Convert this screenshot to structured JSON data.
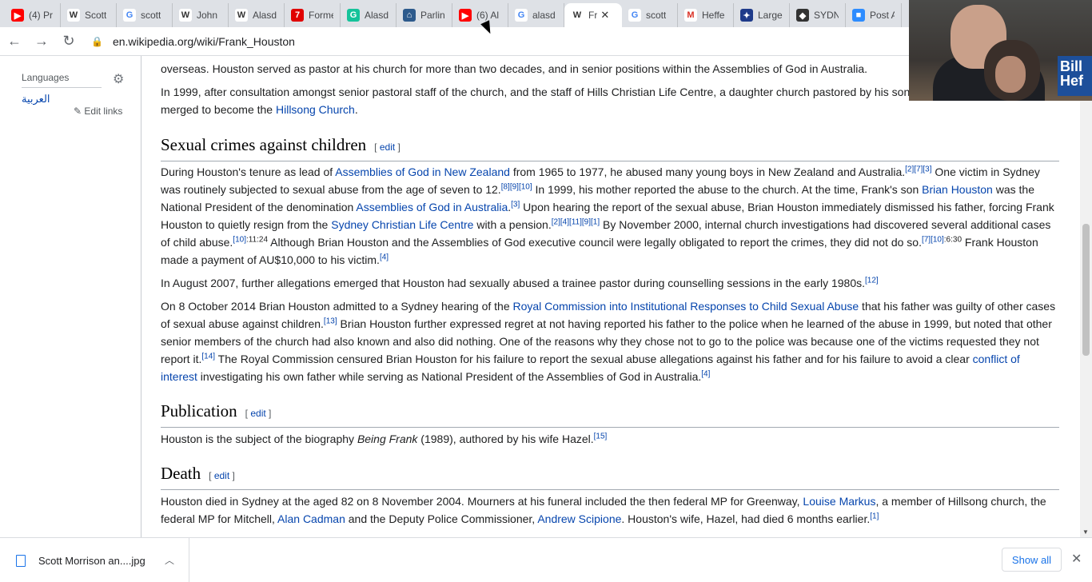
{
  "tabs": [
    {
      "icon": "youtube-icon",
      "color": "#ff0000",
      "glyph": "▶",
      "title": "(4) Pr"
    },
    {
      "icon": "wikipedia-icon",
      "color": "#ffffff",
      "glyph": "W",
      "title": "Scott"
    },
    {
      "icon": "google-icon",
      "color": "#ffffff",
      "glyph": "G",
      "title": "scott"
    },
    {
      "icon": "wikipedia-icon",
      "color": "#ffffff",
      "glyph": "W",
      "title": "John"
    },
    {
      "icon": "wikipedia-icon",
      "color": "#ffffff",
      "glyph": "W",
      "title": "Alasd"
    },
    {
      "icon": "seven-news-icon",
      "color": "#e00000",
      "glyph": "7",
      "title": "Forme"
    },
    {
      "icon": "grammarly-icon",
      "color": "#15c39a",
      "glyph": "G",
      "title": "Alasd"
    },
    {
      "icon": "parliament-icon",
      "color": "#2d5a8c",
      "glyph": "⌂",
      "title": "Parlin"
    },
    {
      "icon": "youtube-icon",
      "color": "#ff0000",
      "glyph": "▶",
      "title": "(6) Al"
    },
    {
      "icon": "google-icon",
      "color": "#ffffff",
      "glyph": "G",
      "title": "alasd"
    },
    {
      "icon": "wikipedia-icon",
      "color": "#ffffff",
      "glyph": "W",
      "title": "Fr",
      "active": true
    },
    {
      "icon": "google-icon",
      "color": "#ffffff",
      "glyph": "G",
      "title": "scott"
    },
    {
      "icon": "gmail-icon",
      "color": "#ffffff",
      "glyph": "M",
      "title": "Heffe"
    },
    {
      "icon": "masonic-icon",
      "color": "#1e3a8a",
      "glyph": "✦",
      "title": "Large"
    },
    {
      "icon": "sydney-icon",
      "color": "#333333",
      "glyph": "◆",
      "title": "SYDN"
    },
    {
      "icon": "zoom-icon",
      "color": "#2d8cff",
      "glyph": "■",
      "title": "Post A"
    }
  ],
  "address": {
    "url": "en.wikipedia.org/wiki/Frank_Houston"
  },
  "sidebar": {
    "languages_heading": "Languages",
    "arabic": "العربية",
    "edit_links": "✎ Edit links"
  },
  "intro": {
    "p1": "overseas. Houston served as pastor at his church for more than two decades, and in senior positions within the Assemblies of God in Australia.",
    "p2a": "In 1999, after consultation amongst senior pastoral staff of the church, and the staff of Hills Christian Life Centre, a daughter church pastored by his son",
    "p2b": "merged to become the ",
    "p2link": "Hillsong Church",
    "p2c": "."
  },
  "sec1": {
    "title": "Sexual crimes against children",
    "edit": "edit",
    "para1": {
      "t1": "During Houston's tenure as lead of ",
      "l1": "Assemblies of God in New Zealand",
      "t2": " from 1965 to 1977, he abused many young boys in New Zealand and Australia.",
      "s1": "[2][7][3]",
      "t3": " One victim in Sydney was routinely subjected to sexual abuse from the age of seven to 12.",
      "s2": "[8][9][10]",
      "t4": " In 1999, his mother reported the abuse to the church. At the time, Frank's son ",
      "l2": "Brian Houston",
      "t5": " was the National President of the denomination ",
      "l3": "Assemblies of God in Australia",
      "t6": ".",
      "s3": "[3]",
      "t7": " Upon hearing the report of the sexual abuse, Brian Houston immediately dismissed his father, forcing Frank Houston to quietly resign from the ",
      "l4": "Sydney Christian Life Centre",
      "t8": " with a pension.",
      "s4": "[2][4][11][9][1]",
      "t9": " By November 2000, internal church investigations had discovered several additional cases of child abuse.",
      "s5": "[10]",
      "s5p": ":11:24",
      "t10": " Although Brian Houston and the Assemblies of God executive council were legally obligated to report the crimes, they did not do so.",
      "s6": "[7][10]",
      "s6p": ":6:30",
      "t11": " Frank Houston made a payment of AU$10,000 to his victim.",
      "s7": "[4]"
    },
    "para2": {
      "t1": "In August 2007, further allegations emerged that Houston had sexually abused a trainee pastor during counselling sessions in the early 1980s.",
      "s1": "[12]"
    },
    "para3": {
      "t1": "On 8 October 2014 Brian Houston admitted to a Sydney hearing of the ",
      "l1": "Royal Commission into Institutional Responses to Child Sexual Abuse",
      "t2": " that his father was guilty of other cases of sexual abuse against children.",
      "s1": "[13]",
      "t3": " Brian Houston further expressed regret at not having reported his father to the police when he learned of the abuse in 1999, but noted that other senior members of the church had also known and also did nothing. One of the reasons why they chose not to go to the police was because one of the victims requested they not report it.",
      "s2": "[14]",
      "t4": " The Royal Commission censured Brian Houston for his failure to report the sexual abuse allegations against his father and for his failure to avoid a clear ",
      "l2": "conflict of interest",
      "t5": " investigating his own father while serving as National President of the Assemblies of God in Australia.",
      "s3": "[4]"
    }
  },
  "sec2": {
    "title": "Publication",
    "edit": "edit",
    "t1": "Houston is the subject of the biography ",
    "em": "Being Frank",
    "t2": " (1989), authored by his wife Hazel.",
    "s1": "[15]"
  },
  "sec3": {
    "title": "Death",
    "edit": "edit",
    "t1": "Houston died in Sydney at the aged 82 on 8 November 2004. Mourners at his funeral included the then federal MP for Greenway, ",
    "l1": "Louise Markus",
    "t2": ", a member of Hillsong church, the federal MP for Mitchell, ",
    "l2": "Alan Cadman",
    "t3": " and the Deputy Police Commissioner, ",
    "l3": "Andrew Scipione",
    "t4": ". Houston's wife, Hazel, had died 6 months earlier.",
    "s1": "[1]"
  },
  "video": {
    "banner": "Bill Hef"
  },
  "downloads": {
    "file": "Scott Morrison an....jpg",
    "show_all": "Show all"
  }
}
